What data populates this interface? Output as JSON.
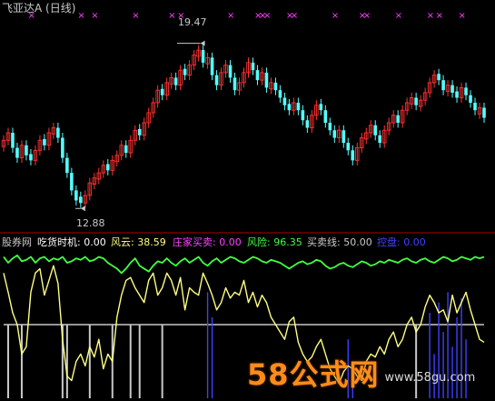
{
  "colors": {
    "background": "#000000",
    "candle_up": "#ff3232",
    "candle_down": "#54ffff",
    "marker": "#ff40ff",
    "divider": "#b00000",
    "title": "#c8c8c8",
    "peak_label": "#c8c8c8",
    "chihuo": "#ffffff",
    "fengyun": "#ffff80",
    "zhuangjia": "#ff40ff",
    "fengxian": "#40ff40",
    "maimai": "#c8c8c8",
    "kongpan": "#4040ff"
  },
  "header": {
    "title": "飞亚达A (日线)"
  },
  "price_panel": {
    "high_label": "19.47",
    "low_label": "12.88"
  },
  "indicator_panel": {
    "name": "股券网",
    "items": [
      {
        "label": "吃货时机: 0.00"
      },
      {
        "label": "风云: 38.59"
      },
      {
        "label": "庄家买卖: 0.00"
      },
      {
        "label": "风险: 96.35"
      },
      {
        "label": "买卖线: 50.00"
      },
      {
        "label": "控盘: 0.00"
      }
    ]
  },
  "watermark": {
    "logo": "58公式网",
    "url": "www.58gu.com"
  },
  "chart_data": [
    {
      "type": "candlestick",
      "title": "飞亚达A (日线)",
      "annotations": [
        {
          "text": "19.47",
          "value": 19.47,
          "kind": "high"
        },
        {
          "text": "12.88",
          "value": 12.88,
          "kind": "low"
        }
      ],
      "ylim": [
        12.2,
        20.4
      ],
      "closes": [
        15.6,
        15.9,
        15.3,
        14.9,
        15.4,
        15.0,
        14.8,
        15.2,
        15.6,
        15.4,
        15.9,
        16.1,
        15.7,
        14.9,
        14.3,
        13.6,
        13.2,
        13.1,
        13.4,
        13.9,
        14.1,
        14.3,
        14.6,
        14.4,
        14.8,
        15.0,
        15.4,
        15.1,
        15.6,
        16.0,
        15.8,
        16.3,
        16.7,
        17.1,
        17.6,
        17.4,
        17.9,
        18.1,
        17.8,
        18.4,
        18.2,
        18.6,
        19.0,
        19.2,
        18.7,
        18.9,
        18.2,
        17.8,
        18.3,
        18.6,
        18.1,
        17.6,
        17.9,
        18.3,
        18.7,
        18.4,
        18.0,
        18.3,
        17.7,
        17.9,
        17.6,
        17.3,
        17.0,
        16.8,
        17.1,
        16.8,
        16.4,
        16.1,
        16.6,
        17.0,
        16.8,
        16.3,
        16.0,
        15.7,
        16.0,
        15.5,
        15.2,
        14.8,
        15.3,
        15.7,
        15.9,
        16.2,
        15.8,
        15.5,
        16.0,
        16.3,
        16.6,
        16.3,
        16.8,
        17.1,
        17.3,
        17.0,
        17.2,
        17.5,
        17.9,
        18.2,
        18.0,
        17.6,
        17.8,
        17.5,
        17.3,
        17.7,
        17.4,
        17.1,
        16.8,
        16.9,
        16.5
      ],
      "up_flags": [
        1,
        1,
        0,
        0,
        1,
        0,
        0,
        1,
        1,
        0,
        1,
        1,
        0,
        0,
        0,
        0,
        0,
        0,
        1,
        1,
        1,
        1,
        1,
        0,
        1,
        1,
        1,
        0,
        1,
        1,
        0,
        1,
        1,
        1,
        1,
        0,
        1,
        1,
        0,
        1,
        0,
        1,
        1,
        1,
        0,
        1,
        0,
        0,
        1,
        1,
        0,
        0,
        1,
        1,
        1,
        0,
        0,
        1,
        0,
        1,
        0,
        0,
        0,
        0,
        1,
        0,
        0,
        0,
        1,
        1,
        0,
        0,
        0,
        0,
        1,
        0,
        0,
        0,
        1,
        1,
        1,
        1,
        0,
        0,
        1,
        1,
        1,
        0,
        1,
        1,
        1,
        0,
        1,
        1,
        1,
        1,
        0,
        0,
        1,
        0,
        0,
        1,
        0,
        0,
        0,
        1,
        0
      ],
      "markers": [
        6,
        17,
        20,
        29,
        37,
        39,
        50,
        56,
        57,
        58,
        63,
        64,
        73,
        79,
        80,
        87,
        94,
        96,
        101
      ]
    },
    {
      "type": "line",
      "title": "股券网",
      "ylim": [
        0,
        100
      ],
      "x": [
        0,
        1,
        2,
        3,
        4,
        5,
        6,
        7,
        8,
        9,
        10,
        11,
        12,
        13,
        14,
        15,
        16,
        17,
        18,
        19,
        20,
        21,
        22,
        23,
        24,
        25,
        26,
        27,
        28,
        29,
        30,
        31,
        32,
        33,
        34,
        35,
        36,
        37,
        38,
        39,
        40,
        41,
        42,
        43,
        44,
        45,
        46,
        47,
        48,
        49,
        50,
        51,
        52,
        53,
        54,
        55,
        56,
        57,
        58,
        59,
        60,
        61,
        62,
        63,
        64,
        65,
        66,
        67,
        68,
        69,
        70,
        71,
        72,
        73,
        74,
        75,
        76,
        77,
        78,
        79,
        80,
        81,
        82,
        83,
        84,
        85,
        86,
        87,
        88,
        89,
        90,
        91,
        92,
        93,
        94,
        95,
        96,
        97,
        98,
        99,
        100,
        101,
        102,
        103,
        104,
        105,
        106
      ],
      "series": [
        {
          "name": "风云",
          "values": [
            85,
            72,
            58,
            50,
            30,
            35,
            72,
            85,
            88,
            70,
            80,
            90,
            78,
            40,
            15,
            12,
            25,
            30,
            22,
            35,
            28,
            40,
            20,
            30,
            25,
            55,
            70,
            80,
            82,
            75,
            70,
            65,
            80,
            85,
            70,
            75,
            85,
            80,
            70,
            82,
            60,
            75,
            72,
            70,
            85,
            78,
            70,
            60,
            65,
            75,
            68,
            72,
            70,
            80,
            65,
            72,
            62,
            70,
            65,
            55,
            50,
            45,
            40,
            52,
            55,
            38,
            30,
            25,
            28,
            35,
            40,
            30,
            20,
            15,
            10,
            18,
            22,
            20,
            15,
            12,
            25,
            30,
            28,
            35,
            30,
            40,
            45,
            35,
            40,
            50,
            55,
            45,
            50,
            62,
            70,
            65,
            58,
            60,
            52,
            70,
            58,
            65,
            72,
            60,
            50,
            40,
            38
          ]
        },
        {
          "name": "风险",
          "values": [
            96,
            92,
            95,
            97,
            93,
            94,
            96,
            92,
            95,
            96,
            93,
            95,
            94,
            96,
            92,
            93,
            95,
            94,
            96,
            93,
            94,
            96,
            95,
            92,
            90,
            88,
            85,
            88,
            92,
            95,
            90,
            88,
            86,
            90,
            93,
            92,
            95,
            92,
            90,
            93,
            95,
            92,
            94,
            96,
            92,
            90,
            93,
            95,
            92,
            94,
            96,
            95,
            93,
            92,
            94,
            96,
            95,
            93,
            92,
            94,
            93,
            92,
            90,
            88,
            90,
            92,
            93,
            91,
            92,
            94,
            93,
            90,
            88,
            89,
            91,
            92,
            90,
            89,
            91,
            93,
            92,
            90,
            91,
            93,
            92,
            94,
            93,
            92,
            94,
            95,
            93,
            92,
            94,
            95,
            93,
            92,
            94,
            96,
            95,
            93,
            94,
            96,
            95,
            94,
            96,
            95,
            96
          ]
        },
        {
          "name": "买卖线",
          "values": [
            50,
            50,
            50,
            50,
            50,
            50,
            50,
            50,
            50,
            50,
            50,
            50,
            50,
            50,
            50,
            50,
            50,
            50,
            50,
            50,
            50,
            50,
            50,
            50,
            50,
            50,
            50,
            50,
            50,
            50,
            50,
            50,
            50,
            50,
            50,
            50,
            50,
            50,
            50,
            50,
            50,
            50,
            50,
            50,
            50,
            50,
            50,
            50,
            50,
            50,
            50,
            50,
            50,
            50,
            50,
            50,
            50,
            50,
            50,
            50,
            50,
            50,
            50,
            50,
            50,
            50,
            50,
            50,
            50,
            50,
            50,
            50,
            50,
            50,
            50,
            50,
            50,
            50,
            50,
            50,
            50,
            50,
            50,
            50,
            50,
            50,
            50,
            50,
            50,
            50,
            50,
            50,
            50,
            50,
            50,
            50,
            50,
            50,
            50,
            50,
            50,
            50,
            50,
            50,
            50,
            50,
            50
          ]
        },
        {
          "name": "吃货时机",
          "values": [
            0,
            1,
            0,
            0,
            1,
            0,
            0,
            0,
            0,
            0,
            0,
            0,
            0,
            1,
            1,
            0,
            0,
            0,
            0,
            1,
            0,
            0,
            0,
            0,
            1,
            0,
            0,
            0,
            1,
            0,
            1,
            0,
            0,
            0,
            0,
            1,
            0,
            0,
            0,
            0,
            0,
            0,
            0,
            0,
            0,
            0,
            0,
            0,
            0,
            0,
            0,
            0,
            0,
            0,
            0,
            0,
            0,
            0,
            0,
            0,
            0,
            0,
            0,
            0,
            0,
            0,
            0,
            0,
            0,
            0,
            0,
            0,
            0,
            0,
            0,
            0,
            0,
            0,
            0,
            0,
            0,
            0,
            0,
            0,
            0,
            0,
            0,
            0,
            0,
            0,
            0,
            1,
            0,
            0,
            0,
            0,
            0,
            0,
            0,
            0,
            0,
            0,
            0,
            0,
            0,
            0,
            0
          ]
        },
        {
          "name": "控盘",
          "values": [
            0,
            0,
            0,
            0,
            0,
            0,
            0,
            0,
            0,
            0,
            0,
            0,
            0,
            0,
            0,
            0,
            0,
            0,
            0,
            0,
            0,
            0,
            0,
            0,
            0,
            0,
            0,
            0,
            0,
            0,
            0,
            0,
            0,
            0,
            0,
            0,
            0,
            0,
            0,
            0,
            0,
            0,
            0,
            0,
            0,
            72,
            55,
            0,
            0,
            0,
            0,
            0,
            0,
            0,
            0,
            0,
            0,
            0,
            0,
            0,
            0,
            0,
            0,
            0,
            0,
            0,
            0,
            0,
            0,
            0,
            0,
            0,
            0,
            0,
            0,
            0,
            40,
            22,
            0,
            0,
            0,
            0,
            0,
            0,
            0,
            0,
            0,
            0,
            0,
            0,
            0,
            0,
            0,
            0,
            58,
            30,
            65,
            45,
            72,
            35,
            55,
            68,
            40,
            0,
            0,
            0,
            0
          ]
        }
      ]
    }
  ]
}
